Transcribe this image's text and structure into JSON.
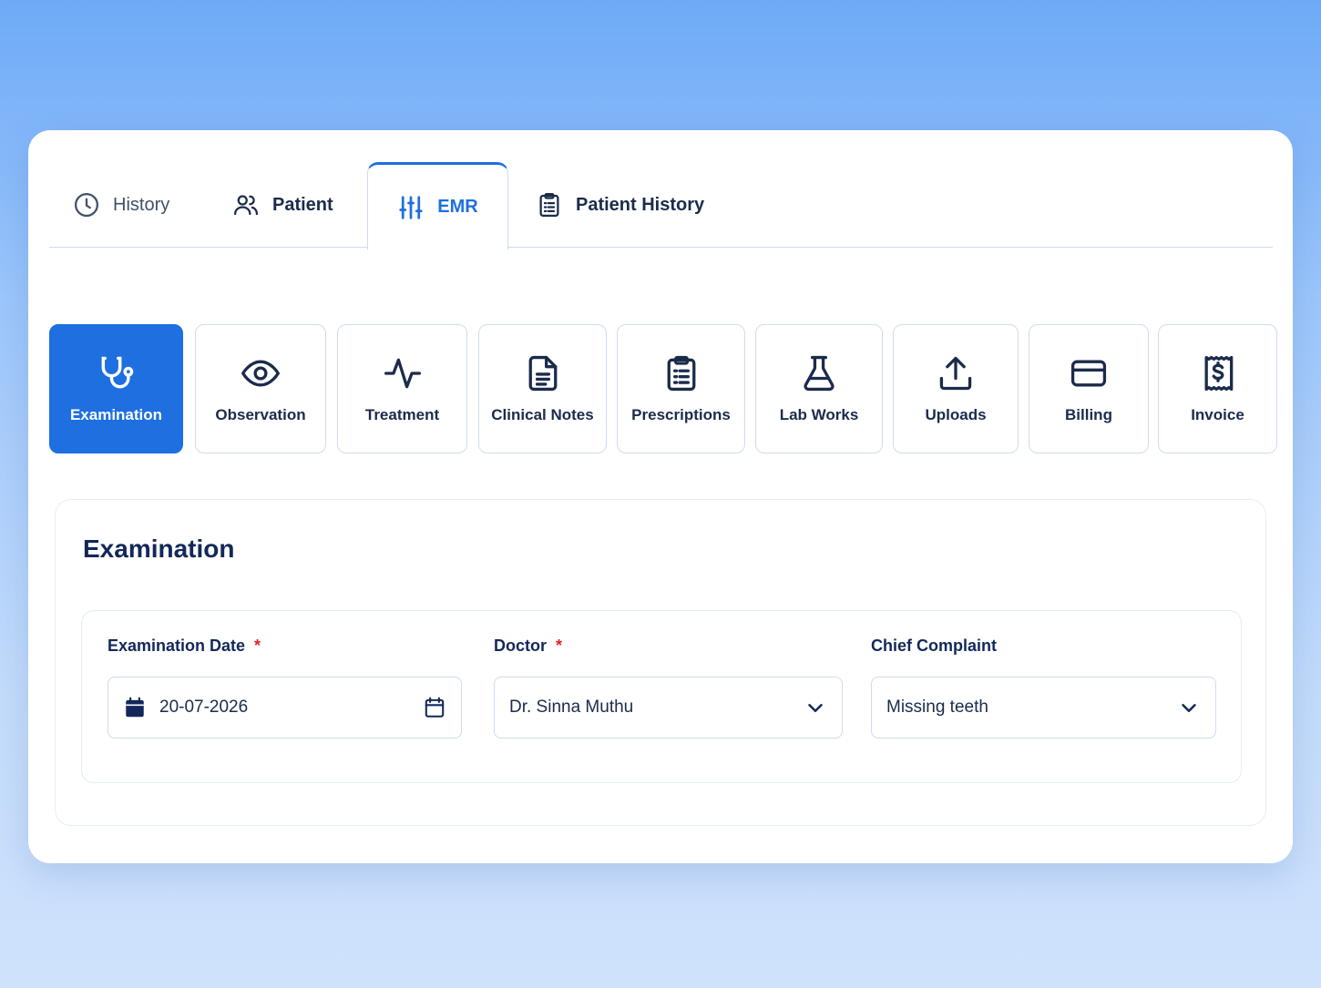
{
  "tabs": [
    {
      "label": "History",
      "icon": "clock-icon",
      "active": false
    },
    {
      "label": "Patient",
      "icon": "users-icon",
      "active": false
    },
    {
      "label": "EMR",
      "icon": "sliders-icon",
      "active": true
    },
    {
      "label": "Patient History",
      "icon": "clipboard-list-icon",
      "active": false
    }
  ],
  "modules": [
    {
      "label": "Examination",
      "icon": "stethoscope-icon",
      "active": true
    },
    {
      "label": "Observation",
      "icon": "eye-icon",
      "active": false
    },
    {
      "label": "Treatment",
      "icon": "pulse-icon",
      "active": false
    },
    {
      "label": "Clinical Notes",
      "icon": "document-icon",
      "active": false
    },
    {
      "label": "Prescriptions",
      "icon": "clipboard-icon",
      "active": false
    },
    {
      "label": "Lab Works",
      "icon": "flask-icon",
      "active": false
    },
    {
      "label": "Uploads",
      "icon": "upload-icon",
      "active": false
    },
    {
      "label": "Billing",
      "icon": "credit-card-icon",
      "active": false
    },
    {
      "label": "Invoice",
      "icon": "receipt-icon",
      "active": false
    }
  ],
  "section": {
    "title": "Examination"
  },
  "form": {
    "exam_date": {
      "label": "Examination Date",
      "required_mark": "*",
      "value": "20-07-2026"
    },
    "doctor": {
      "label": "Doctor",
      "required_mark": "*",
      "value": "Dr. Sinna Muthu"
    },
    "chief_complaint": {
      "label": "Chief Complaint",
      "value": "Missing teeth"
    }
  },
  "colors": {
    "accent": "#1e6fe0",
    "text": "#13285a",
    "required": "#e02424"
  }
}
